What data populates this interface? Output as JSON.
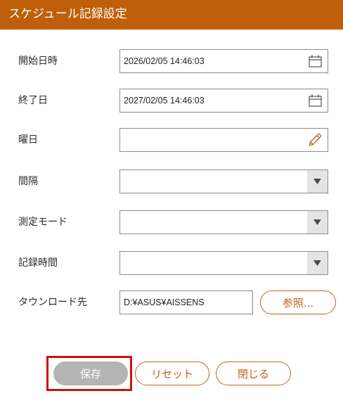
{
  "window": {
    "title": "スケジュール記録設定"
  },
  "form": {
    "start_datetime": {
      "label": "開始日時",
      "value": "2026/02/05 14:46:03",
      "icon": "calendar-icon"
    },
    "end_date": {
      "label": "終了日",
      "value": "2027/02/05 14:46:03",
      "icon": "calendar-icon"
    },
    "weekday": {
      "label": "曜日",
      "icon": "pencil-icon"
    },
    "interval": {
      "label": "間隔",
      "icon": "dropdown-arrow-icon"
    },
    "measurement_mode": {
      "label": "測定モード",
      "icon": "dropdown-arrow-icon"
    },
    "recording_time": {
      "label": "記録時間",
      "icon": "dropdown-arrow-icon"
    },
    "download_dest": {
      "label": "タウンロード先",
      "value": "D:¥ASUS¥AISSENS",
      "browse_label": "参照..."
    }
  },
  "footer": {
    "save_label": "保存",
    "reset_label": "リセット",
    "close_label": "閉じる"
  },
  "colors": {
    "accent": "#C0641C",
    "title_bar": "#BF5F0A",
    "save_button": "#B4B4B4",
    "highlight": "#CC1111"
  }
}
